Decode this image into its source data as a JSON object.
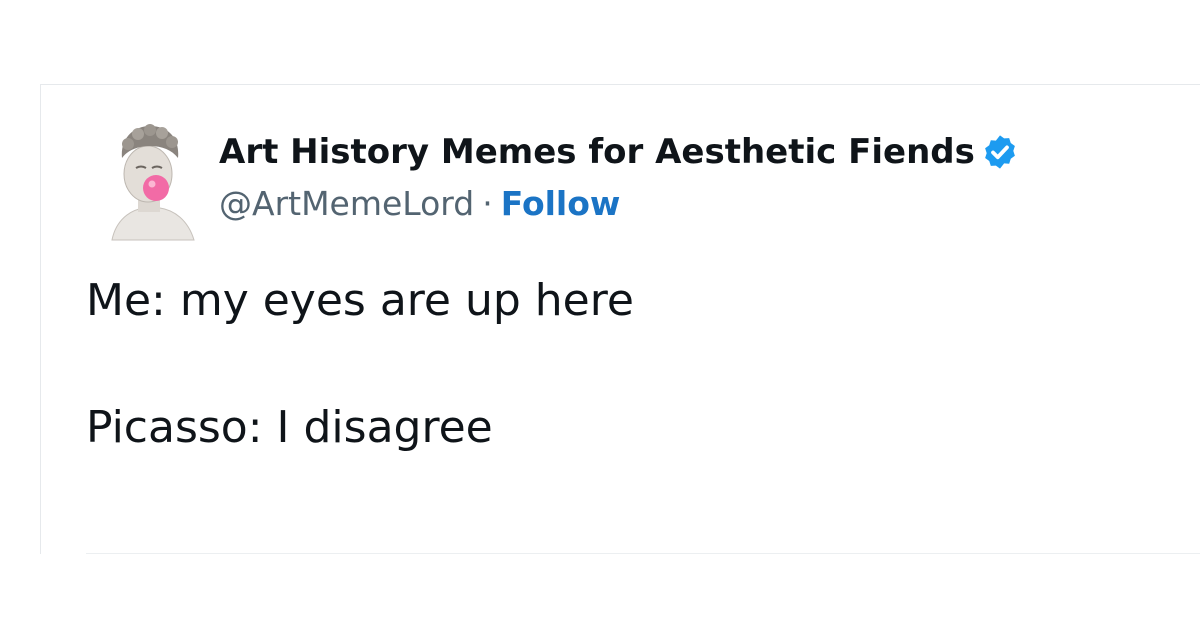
{
  "tweet": {
    "author_name": "Art History Memes for Aesthetic Fiends",
    "handle": "@ArtMemeLord",
    "separator": "·",
    "follow_label": "Follow",
    "verified_icon": "verified-badge-icon",
    "avatar_icon": "classical-statue-bubblegum-avatar",
    "lines": [
      "Me: my eyes are up here",
      "Picasso: I disagree"
    ]
  },
  "colors": {
    "text": "#0f1419",
    "secondary_text": "#536471",
    "link": "#1b74c5",
    "verified": "#1d9bf0",
    "border": "#e6e9ec"
  }
}
